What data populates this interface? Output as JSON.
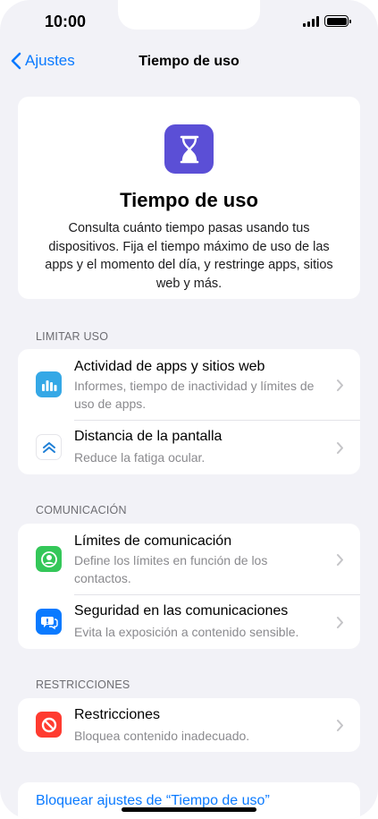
{
  "status_bar": {
    "time": "10:00"
  },
  "nav": {
    "back_label": "Ajustes",
    "title": "Tiempo de uso"
  },
  "hero": {
    "title": "Tiempo de uso",
    "description": "Consulta cuánto tiempo pasas usando tus dispositivos. Fija el tiempo máximo de uso de las apps y el momento del día, y restringe apps, sitios web y más."
  },
  "sections": [
    {
      "header": "LIMITAR USO",
      "items": [
        {
          "title": "Actividad de apps y sitios web",
          "subtitle": "Informes, tiempo de inactividad y límites de uso de apps.",
          "icon": "bar-chart-icon",
          "color": "#35a8e6"
        },
        {
          "title": "Distancia de la pantalla",
          "subtitle": "Reduce la fatiga ocular.",
          "icon": "chevrons-up-icon",
          "color": "#1f7fd6"
        }
      ]
    },
    {
      "header": "COMUNICACIÓN",
      "items": [
        {
          "title": "Límites de comunicación",
          "subtitle": "Define los límites en función de los contactos.",
          "icon": "person-circle-icon",
          "color": "#34c759"
        },
        {
          "title": "Seguridad en las comunicaciones",
          "subtitle": "Evita la exposición a contenido sensible.",
          "icon": "chat-bubble-icon",
          "color": "#0a7aff"
        }
      ]
    },
    {
      "header": "RESTRICCIONES",
      "items": [
        {
          "title": "Restricciones",
          "subtitle": "Bloquea contenido inadecuado.",
          "icon": "no-entry-icon",
          "color": "#ff3b30"
        }
      ]
    }
  ],
  "bottom_link": "Bloquear ajustes de “Tiempo de uso”"
}
